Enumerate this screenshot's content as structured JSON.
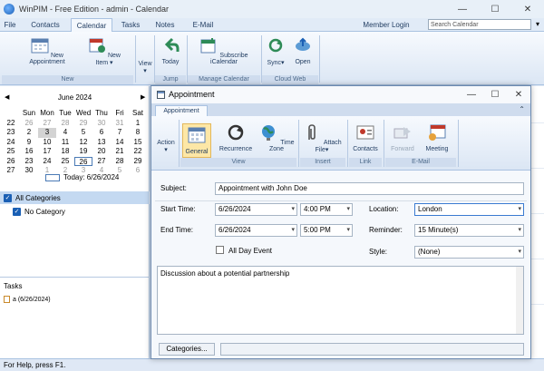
{
  "window": {
    "title": "WinPIM - Free Edition - admin - Calendar"
  },
  "menu": {
    "tabs": [
      "File",
      "Contacts",
      "Calendar",
      "Tasks",
      "Notes",
      "E-Mail"
    ],
    "login": "Member Login",
    "search_placeholder": "Search Calendar"
  },
  "ribbon": {
    "new_appointment": "New Appointment",
    "new_item": "New Item",
    "group_new": "New",
    "view": "View",
    "today": "Today",
    "group_jump": "Jump",
    "subscribe": "Subscribe iCalendar",
    "group_manage": "Manage Calendar",
    "sync": "Sync",
    "open": "Open",
    "group_cloud": "Cloud Web"
  },
  "calendar": {
    "month": "June 2024",
    "weekdays": [
      "Sun",
      "Mon",
      "Tue",
      "Wed",
      "Thu",
      "Fri",
      "Sat"
    ],
    "weeks": [
      [
        22,
        26,
        27,
        28,
        29,
        30,
        31,
        1
      ],
      [
        23,
        2,
        3,
        4,
        5,
        6,
        7,
        8
      ],
      [
        24,
        9,
        10,
        11,
        12,
        13,
        14,
        15
      ],
      [
        25,
        16,
        17,
        18,
        19,
        20,
        21,
        22
      ],
      [
        26,
        23,
        24,
        25,
        26,
        27,
        28,
        29
      ],
      [
        27,
        30,
        1,
        2,
        3,
        4,
        5,
        6
      ]
    ],
    "today_label": "Today: 6/26/2024"
  },
  "categories": {
    "header": "All Categories",
    "items": [
      "No Category"
    ]
  },
  "tasks": {
    "title": "Tasks",
    "items": [
      "a (6/26/2024)"
    ]
  },
  "status": {
    "text": "For Help, press F1."
  },
  "dialog": {
    "title": "Appointment",
    "tab": "Appointment",
    "ribbon": {
      "action": "Action",
      "general": "General",
      "recurrence": "Recurrence",
      "time_zone": "Time Zone",
      "group_view": "View",
      "attach_file": "Attach File",
      "group_insert": "Insert",
      "contacts": "Contacts",
      "group_link": "Link",
      "forward": "Forward",
      "meeting": "Meeting",
      "group_email": "E-Mail"
    },
    "form": {
      "subject_label": "Subject:",
      "subject": "Appointment with John Doe",
      "start_label": "Start Time:",
      "start_date": "6/26/2024",
      "start_time": "4:00 PM",
      "end_label": "End Time:",
      "end_date": "6/26/2024",
      "end_time": "5:00 PM",
      "location_label": "Location:",
      "location": "London",
      "reminder_label": "Reminder:",
      "reminder": "15 Minute(s)",
      "allday_label": "All Day Event",
      "style_label": "Style:",
      "style": "(None)",
      "notes": "Discussion about a potential partnership",
      "categories_button": "Categories..."
    }
  }
}
